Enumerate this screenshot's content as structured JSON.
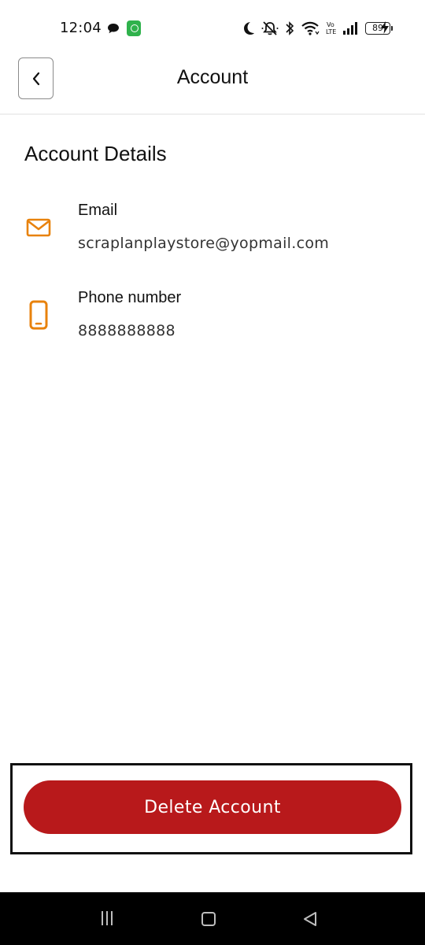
{
  "status_bar": {
    "time": "12:04",
    "battery_level": "89",
    "network_label": "Vo LTE"
  },
  "header": {
    "title": "Account",
    "back_icon": "chevron-left-icon"
  },
  "section": {
    "title": "Account Details"
  },
  "details": {
    "email": {
      "label": "Email",
      "value": "scraplanplaystore@yopmail.com",
      "icon": "envelope-icon"
    },
    "phone": {
      "label": "Phone number",
      "value": "8888888888",
      "icon": "smartphone-icon"
    }
  },
  "actions": {
    "delete_label": "Delete Account"
  },
  "colors": {
    "accent_icon": "#e8820c",
    "delete_button": "#b8191b",
    "nav_bar": "#000000"
  }
}
